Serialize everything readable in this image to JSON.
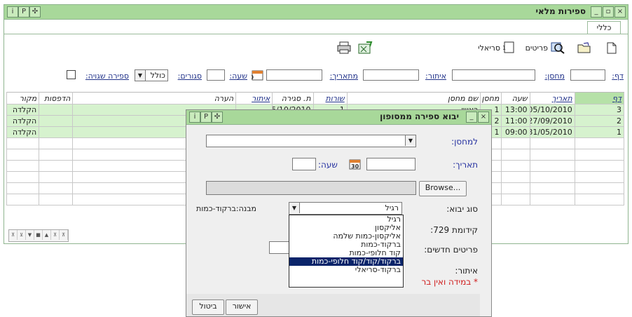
{
  "window": {
    "title": "ספירות מלאי",
    "title_buttons": [
      "i",
      "P",
      "✣"
    ],
    "controls": [
      "×",
      "▫",
      "_"
    ],
    "tab": "כללי",
    "toolbar": {
      "items_label": "פריטים",
      "serial_label": "סריאלי"
    },
    "filters": {
      "page_label": "דף:",
      "warehouse_label": "מחסן:",
      "location_label": "איתור:",
      "from_date_label": "מתאריך:",
      "time_label": "שעה:",
      "closed_label": "סגורים:",
      "closed_value": "כולל",
      "wrong_count_label": "ספירה שגויה:"
    },
    "grid": {
      "columns": [
        "דף",
        "תאריך",
        "שעה",
        "מחסן",
        "שם מחסן",
        "שורות",
        "ת. סגירה",
        "איתור",
        "הערה",
        "הדפסות",
        "מקור"
      ],
      "rows": [
        [
          "3",
          "05/10/2010",
          "13:00",
          "1",
          "ראשי",
          "1",
          "05/10/2010",
          "",
          "",
          "",
          "הקלדה"
        ],
        [
          "2",
          "27/09/2010",
          "11:00",
          "2",
          "",
          "",
          "",
          "",
          "",
          "",
          "הקלדה"
        ],
        [
          "1",
          "31/05/2010",
          "09:00",
          "1",
          "",
          "",
          "",
          "",
          "",
          "",
          "הקלדה"
        ]
      ]
    },
    "nav": [
      "⊼",
      "⊻",
      "▼",
      "■",
      "▲",
      "⊼",
      "⊼"
    ]
  },
  "dialog": {
    "title": "יבוא ספירה ממסופון",
    "title_buttons": [
      "i",
      "P",
      "✣"
    ],
    "controls": [
      "×",
      "_"
    ],
    "to_warehouse_label": "למחסן:",
    "date_label": "תאריך:",
    "time_label": "שעה:",
    "browse_label": "Browse...",
    "import_type_label": "סוג יבוא:",
    "import_type_value": "רגיל",
    "structure_text": "מבנה:ברקוד-כמות",
    "prefix_label": "קידומת 729:",
    "new_items_label": "פריטים חדשים:",
    "location_label": "איתור:",
    "note": "* במידה ואין בר",
    "options": [
      "רגיל",
      "אליקסון",
      "אליקסון-כמות שלמה",
      "ברקוד-כמות",
      "קוד חלופי-כמות",
      "ברקוד/קוד/קוד חלופי-כמות",
      "ברקוד-סריאלי"
    ],
    "selected_option_index": 5,
    "ok_label": "אישור",
    "cancel_label": "ביטול"
  }
}
